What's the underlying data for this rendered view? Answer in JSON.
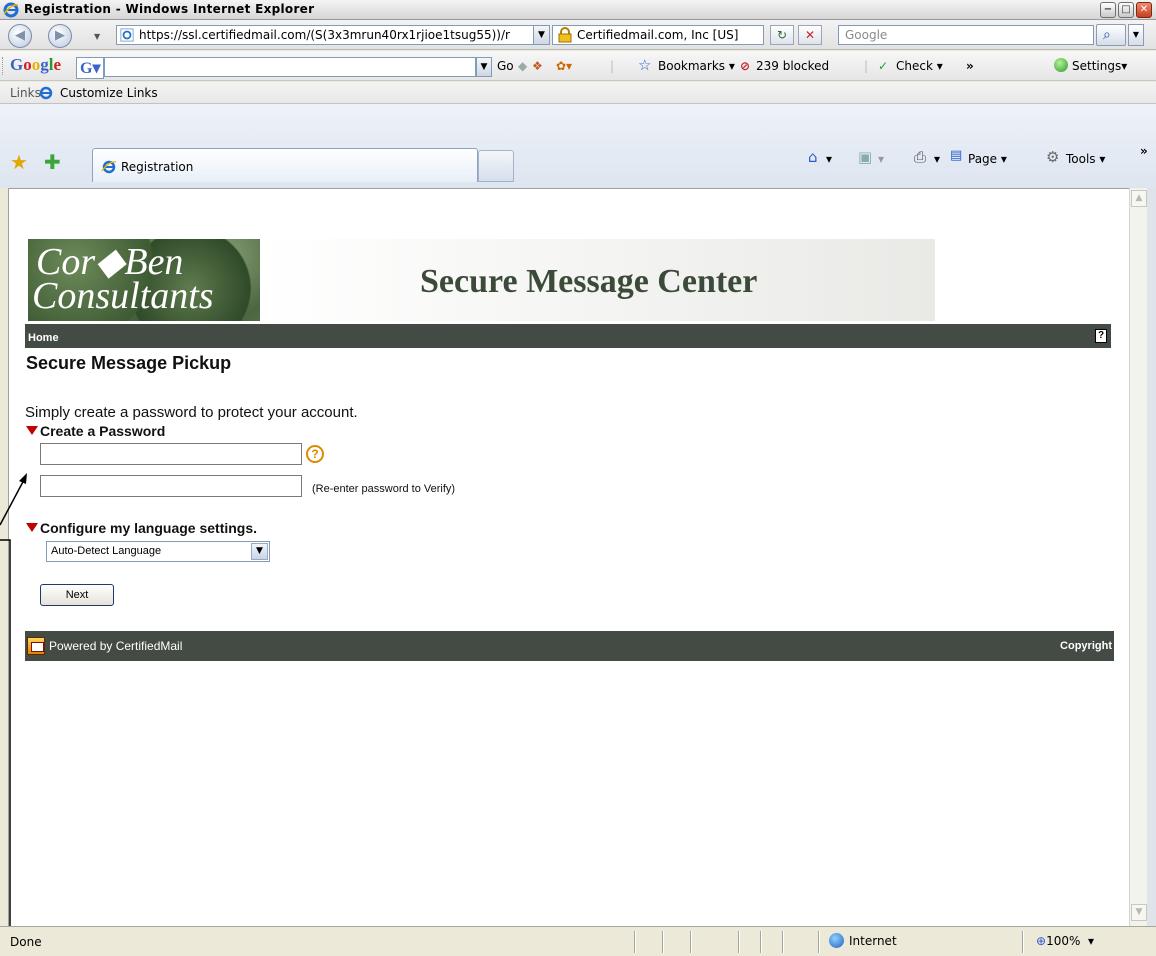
{
  "window": {
    "title": "Registration - Windows Internet Explorer"
  },
  "address_bar": {
    "url": "https://ssl.certifiedmail.com/(S(3x3mrun40rx1rjioe1tsug55))/r",
    "security_label": "Certifiedmail.com, Inc [US]",
    "search_placeholder": "Google"
  },
  "google_toolbar": {
    "logo": "Google",
    "go_label": "Go",
    "bookmarks_label": "Bookmarks",
    "blocked_label": "239 blocked",
    "check_label": "Check",
    "more_label": "»",
    "settings_label": "Settings"
  },
  "links_bar": {
    "label": "Links",
    "item": "Customize Links"
  },
  "tabs": {
    "active_label": "Registration"
  },
  "command_bar": {
    "page_label": "Page",
    "tools_label": "Tools",
    "more_label": "»"
  },
  "page": {
    "logo_line1": "Cor◆Ben",
    "logo_line2": "Consultants",
    "site_title": "Secure Message Center",
    "nav_home": "Home",
    "help_glyph": "?",
    "heading": "Secure Message Pickup",
    "intro": "Simply create a password to protect your account.",
    "password_section": "Create a Password",
    "verify_note": "(Re-enter password to Verify)",
    "language_section": "Configure my language settings.",
    "language_value": "Auto-Detect Language",
    "next_button": "Next",
    "footer_powered": "Powered by CertifiedMail",
    "footer_copyright": "Copyright"
  },
  "status_bar": {
    "status": "Done",
    "zone": "Internet",
    "zoom": "100%"
  }
}
